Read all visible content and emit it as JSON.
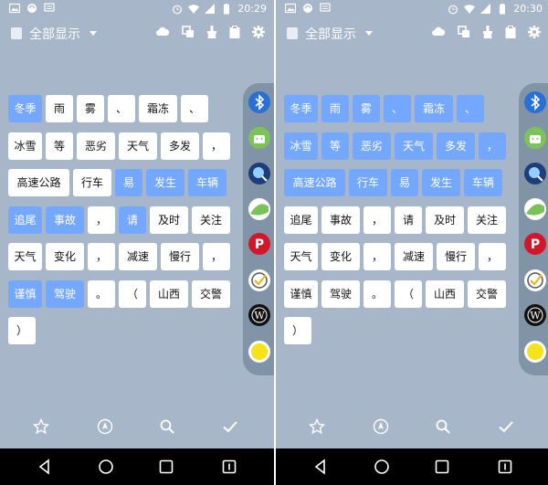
{
  "status_bar": {
    "time_left": "20:29",
    "time_right": "20:30"
  },
  "toolbar": {
    "title": "全部显示"
  },
  "icons": {
    "status": [
      "image-icon",
      "sync-icon",
      "message-icon",
      "alarm-icon",
      "wifi-icon",
      "signal-icon",
      "battery-icon"
    ],
    "toolbar": [
      "cloud-icon",
      "copy-icon",
      "brush-icon",
      "clipboard-icon",
      "gear-icon"
    ],
    "dock": [
      "bluetooth-icon",
      "android-green-icon",
      "browser-search-icon",
      "android-icon",
      "pinterest-icon",
      "checklist-icon",
      "w-app-icon",
      "yellow-sun-icon"
    ],
    "bottom": [
      "star-icon",
      "compass-icon",
      "search-icon",
      "check-icon"
    ],
    "nav": [
      "back-icon",
      "home-icon",
      "recents-icon",
      "menu-icon"
    ]
  },
  "left_screen": {
    "chips": [
      {
        "text": "冬季",
        "selected": true
      },
      {
        "text": "雨",
        "selected": false
      },
      {
        "text": "雾",
        "selected": false
      },
      {
        "text": "、",
        "selected": false
      },
      {
        "text": "霜冻",
        "selected": false
      },
      {
        "text": "、",
        "selected": false
      },
      {
        "text": "冰雪",
        "selected": false
      },
      {
        "text": "等",
        "selected": false
      },
      {
        "text": "恶劣",
        "selected": false
      },
      {
        "text": "天气",
        "selected": false
      },
      {
        "text": "多发",
        "selected": false
      },
      {
        "text": "，",
        "selected": false
      },
      {
        "text": "高速公路",
        "selected": false
      },
      {
        "text": "行车",
        "selected": false
      },
      {
        "text": "易",
        "selected": true
      },
      {
        "text": "发生",
        "selected": true
      },
      {
        "text": "车辆",
        "selected": true
      },
      {
        "text": "追尾",
        "selected": true
      },
      {
        "text": "事故",
        "selected": true
      },
      {
        "text": "，",
        "selected": false
      },
      {
        "text": "请",
        "selected": true
      },
      {
        "text": "及时",
        "selected": false
      },
      {
        "text": "关注",
        "selected": false
      },
      {
        "text": "天气",
        "selected": false
      },
      {
        "text": "变化",
        "selected": false
      },
      {
        "text": "，",
        "selected": false
      },
      {
        "text": "减速",
        "selected": false
      },
      {
        "text": "慢行",
        "selected": false
      },
      {
        "text": "，",
        "selected": false
      },
      {
        "text": "谨慎",
        "selected": true
      },
      {
        "text": "驾驶",
        "selected": true
      },
      {
        "text": "。",
        "selected": false
      },
      {
        "text": "（",
        "selected": false
      },
      {
        "text": "山西",
        "selected": false
      },
      {
        "text": "交警",
        "selected": false
      },
      {
        "text": "）",
        "selected": false
      }
    ]
  },
  "right_screen": {
    "chips": [
      {
        "text": "冬季",
        "selected": true
      },
      {
        "text": "雨",
        "selected": true
      },
      {
        "text": "雾",
        "selected": true
      },
      {
        "text": "、",
        "selected": true
      },
      {
        "text": "霜冻",
        "selected": true
      },
      {
        "text": "、",
        "selected": true
      },
      {
        "text": "冰雪",
        "selected": true
      },
      {
        "text": "等",
        "selected": true
      },
      {
        "text": "恶劣",
        "selected": true
      },
      {
        "text": "天气",
        "selected": true
      },
      {
        "text": "多发",
        "selected": true
      },
      {
        "text": "，",
        "selected": true
      },
      {
        "text": "高速公路",
        "selected": true
      },
      {
        "text": "行车",
        "selected": true
      },
      {
        "text": "易",
        "selected": true
      },
      {
        "text": "发生",
        "selected": true
      },
      {
        "text": "车辆",
        "selected": true
      },
      {
        "text": "追尾",
        "selected": false
      },
      {
        "text": "事故",
        "selected": false
      },
      {
        "text": "，",
        "selected": false
      },
      {
        "text": "请",
        "selected": false
      },
      {
        "text": "及时",
        "selected": false
      },
      {
        "text": "关注",
        "selected": false
      },
      {
        "text": "天气",
        "selected": false
      },
      {
        "text": "变化",
        "selected": false
      },
      {
        "text": "，",
        "selected": false
      },
      {
        "text": "减速",
        "selected": false
      },
      {
        "text": "慢行",
        "selected": false
      },
      {
        "text": "，",
        "selected": false
      },
      {
        "text": "谨慎",
        "selected": false
      },
      {
        "text": "驾驶",
        "selected": false
      },
      {
        "text": "。",
        "selected": false
      },
      {
        "text": "（",
        "selected": false
      },
      {
        "text": "山西",
        "selected": false
      },
      {
        "text": "交警",
        "selected": false
      },
      {
        "text": "）",
        "selected": false
      }
    ]
  },
  "colors": {
    "screen_bg": "#a7b6c9",
    "chip_selected": "#74a7ff",
    "chip_unselected": "#ffffff",
    "dock_bg": "#8193a6",
    "navbar_bg": "#000000"
  }
}
